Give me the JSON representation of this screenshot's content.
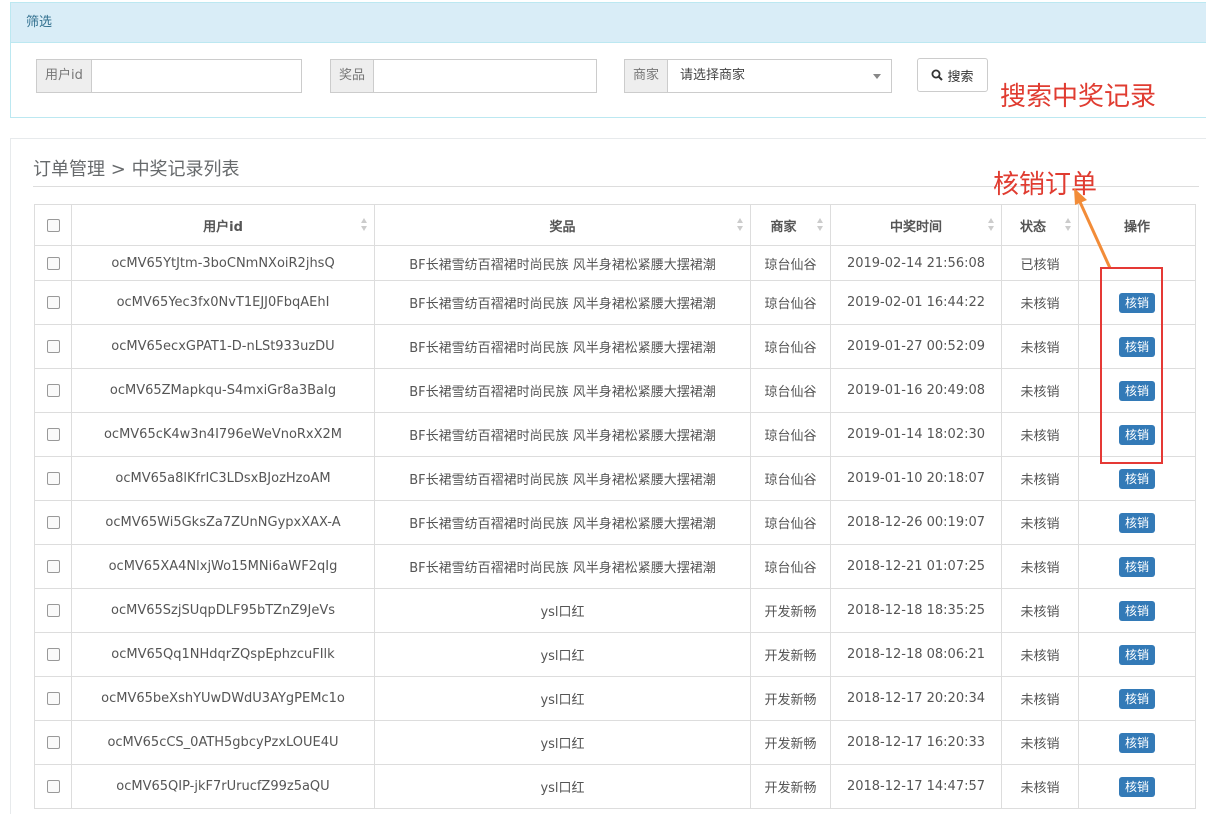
{
  "filter": {
    "title": "筛选",
    "user_id_label": "用户id",
    "user_id_value": "",
    "prize_label": "奖品",
    "prize_value": "",
    "merchant_label": "商家",
    "merchant_selected": "请选择商家",
    "search_label": "搜索"
  },
  "annotations": {
    "search_note": "搜索中奖记录",
    "verify_note": "核销订单"
  },
  "breadcrumb": {
    "section": "订单管理",
    "separator": ">",
    "page": "中奖记录列表"
  },
  "table": {
    "headers": [
      "用户id",
      "奖品",
      "商家",
      "中奖时间",
      "状态",
      "操作"
    ],
    "verify_label": "核销",
    "rows": [
      {
        "user_id": "ocMV65YtJtm-3boCNmNXoiR2jhsQ",
        "prize": "BF长裙雪纺百褶裙时尚民族 风半身裙松紧腰大摆裙潮",
        "merchant": "琼台仙谷",
        "time": "2019-02-14 21:56:08",
        "status": "已核销",
        "has_action": false
      },
      {
        "user_id": "ocMV65Yec3fx0NvT1EJJ0FbqAEhI",
        "prize": "BF长裙雪纺百褶裙时尚民族 风半身裙松紧腰大摆裙潮",
        "merchant": "琼台仙谷",
        "time": "2019-02-01 16:44:22",
        "status": "未核销",
        "has_action": true
      },
      {
        "user_id": "ocMV65ecxGPAT1-D-nLSt933uzDU",
        "prize": "BF长裙雪纺百褶裙时尚民族 风半身裙松紧腰大摆裙潮",
        "merchant": "琼台仙谷",
        "time": "2019-01-27 00:52:09",
        "status": "未核销",
        "has_action": true
      },
      {
        "user_id": "ocMV65ZMapkqu-S4mxiGr8a3BaIg",
        "prize": "BF长裙雪纺百褶裙时尚民族 风半身裙松紧腰大摆裙潮",
        "merchant": "琼台仙谷",
        "time": "2019-01-16 20:49:08",
        "status": "未核销",
        "has_action": true
      },
      {
        "user_id": "ocMV65cK4w3n4I796eWeVnoRxX2M",
        "prize": "BF长裙雪纺百褶裙时尚民族 风半身裙松紧腰大摆裙潮",
        "merchant": "琼台仙谷",
        "time": "2019-01-14 18:02:30",
        "status": "未核销",
        "has_action": true
      },
      {
        "user_id": "ocMV65a8lKfrIC3LDsxBJozHzoAM",
        "prize": "BF长裙雪纺百褶裙时尚民族 风半身裙松紧腰大摆裙潮",
        "merchant": "琼台仙谷",
        "time": "2019-01-10 20:18:07",
        "status": "未核销",
        "has_action": true
      },
      {
        "user_id": "ocMV65Wi5GksZa7ZUnNGypxXAX-A",
        "prize": "BF长裙雪纺百褶裙时尚民族 风半身裙松紧腰大摆裙潮",
        "merchant": "琼台仙谷",
        "time": "2018-12-26 00:19:07",
        "status": "未核销",
        "has_action": true
      },
      {
        "user_id": "ocMV65XA4NlxjWo15MNi6aWF2qIg",
        "prize": "BF长裙雪纺百褶裙时尚民族 风半身裙松紧腰大摆裙潮",
        "merchant": "琼台仙谷",
        "time": "2018-12-21 01:07:25",
        "status": "未核销",
        "has_action": true
      },
      {
        "user_id": "ocMV65SzjSUqpDLF95bTZnZ9JeVs",
        "prize": "ysl口红",
        "merchant": "开发新畅",
        "time": "2018-12-18 18:35:25",
        "status": "未核销",
        "has_action": true
      },
      {
        "user_id": "ocMV65Qq1NHdqrZQspEphzcuFIlk",
        "prize": "ysl口红",
        "merchant": "开发新畅",
        "time": "2018-12-18 08:06:21",
        "status": "未核销",
        "has_action": true
      },
      {
        "user_id": "ocMV65beXshYUwDWdU3AYgPEMc1o",
        "prize": "ysl口红",
        "merchant": "开发新畅",
        "time": "2018-12-17 20:20:34",
        "status": "未核销",
        "has_action": true
      },
      {
        "user_id": "ocMV65cCS_0ATH5gbcyPzxLOUE4U",
        "prize": "ysl口红",
        "merchant": "开发新畅",
        "time": "2018-12-17 16:20:33",
        "status": "未核销",
        "has_action": true
      },
      {
        "user_id": "ocMV65QIP-jkF7rUrucfZ99z5aQU",
        "prize": "ysl口红",
        "merchant": "开发新畅",
        "time": "2018-12-17 14:47:57",
        "status": "未核销",
        "has_action": true
      }
    ]
  }
}
